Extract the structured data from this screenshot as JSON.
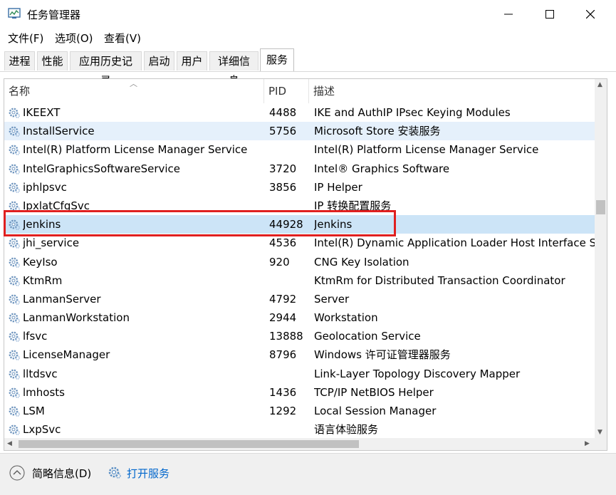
{
  "window": {
    "title": "任务管理器",
    "controls": {
      "minimize": "—",
      "maximize": "☐",
      "close": "✕"
    }
  },
  "menu": [
    "文件(F)",
    "选项(O)",
    "查看(V)"
  ],
  "tabs": [
    {
      "label": "进程",
      "active": false
    },
    {
      "label": "性能",
      "active": false
    },
    {
      "label": "应用历史记录",
      "active": false
    },
    {
      "label": "启动",
      "active": false
    },
    {
      "label": "用户",
      "active": false
    },
    {
      "label": "详细信息",
      "active": false
    },
    {
      "label": "服务",
      "active": true
    }
  ],
  "table": {
    "columns": [
      "名称",
      "PID",
      "描述"
    ],
    "rows": [
      {
        "name": "IKEEXT",
        "pid": "4488",
        "desc": "IKE and AuthIP IPsec Keying Modules",
        "state": ""
      },
      {
        "name": "InstallService",
        "pid": "5756",
        "desc": "Microsoft Store 安装服务",
        "state": "hover"
      },
      {
        "name": "Intel(R) Platform License Manager Service",
        "pid": "",
        "desc": "Intel(R) Platform License Manager Service",
        "state": ""
      },
      {
        "name": "IntelGraphicsSoftwareService",
        "pid": "3720",
        "desc": "Intel® Graphics Software",
        "state": ""
      },
      {
        "name": "iphlpsvc",
        "pid": "3856",
        "desc": "IP Helper",
        "state": ""
      },
      {
        "name": "IpxlatCfgSvc",
        "pid": "",
        "desc": "IP 转换配置服务",
        "state": ""
      },
      {
        "name": "Jenkins",
        "pid": "44928",
        "desc": "Jenkins",
        "state": "selected"
      },
      {
        "name": "jhi_service",
        "pid": "4536",
        "desc": "Intel(R) Dynamic Application Loader Host Interface Ser",
        "state": ""
      },
      {
        "name": "KeyIso",
        "pid": "920",
        "desc": "CNG Key Isolation",
        "state": ""
      },
      {
        "name": "KtmRm",
        "pid": "",
        "desc": "KtmRm for Distributed Transaction Coordinator",
        "state": ""
      },
      {
        "name": "LanmanServer",
        "pid": "4792",
        "desc": "Server",
        "state": ""
      },
      {
        "name": "LanmanWorkstation",
        "pid": "2944",
        "desc": "Workstation",
        "state": ""
      },
      {
        "name": "lfsvc",
        "pid": "13888",
        "desc": "Geolocation Service",
        "state": ""
      },
      {
        "name": "LicenseManager",
        "pid": "8796",
        "desc": "Windows 许可证管理器服务",
        "state": ""
      },
      {
        "name": "lltdsvc",
        "pid": "",
        "desc": "Link-Layer Topology Discovery Mapper",
        "state": ""
      },
      {
        "name": "lmhosts",
        "pid": "1436",
        "desc": "TCP/IP NetBIOS Helper",
        "state": ""
      },
      {
        "name": "LSM",
        "pid": "1292",
        "desc": "Local Session Manager",
        "state": ""
      },
      {
        "name": "LxpSvc",
        "pid": "",
        "desc": "语言体验服务",
        "state": ""
      }
    ]
  },
  "footer": {
    "collapse_label": "简略信息(D)",
    "open_services_label": "打开服务"
  },
  "colors": {
    "highlight_border": "#e02020",
    "selected_row": "#cce4f7",
    "hover_row": "#e5f0fb",
    "link": "#0066cc"
  }
}
